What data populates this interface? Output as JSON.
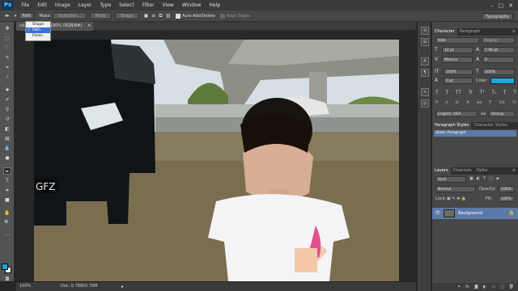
{
  "app": {
    "logo": "Ps"
  },
  "menu": [
    "File",
    "Edit",
    "Image",
    "Layer",
    "Type",
    "Select",
    "Filter",
    "View",
    "Window",
    "Help"
  ],
  "window_controls": [
    "–",
    "▢",
    "✕"
  ],
  "options": {
    "mode_value": "Path",
    "make_label": "Make:",
    "selection_btn": "Selection...",
    "mask_btn": "Mask",
    "shape_btn": "Shape",
    "auto_add_delete": "Auto Add/Delete",
    "align_edges": "Align Edges"
  },
  "workspace": "Typography",
  "mode_dropdown": {
    "items": [
      "Shape",
      "Path",
      "Pixels"
    ],
    "selected": "Path"
  },
  "document": {
    "tab_title": "cd...728.jpg @ 100% (RGB/8#)",
    "close": "✕"
  },
  "status": {
    "zoom": "100%",
    "doc": "Doc: 0.78M/0.78M",
    "arrow": "▸"
  },
  "character_panel": {
    "tabs": [
      "Character",
      "Paragraph"
    ],
    "font_family": "Italo",
    "font_style": "Regular",
    "size": "12 pt",
    "leading": "7.96 pt",
    "kerning": "Metrics",
    "tracking": "0",
    "vscale": "100%",
    "hscale": "100%",
    "baseline": "0 pt",
    "color_label": "Color:",
    "style_buttons": [
      "T",
      "T",
      "TT",
      "Tr",
      "T¹",
      "T₁",
      "T",
      "T"
    ],
    "ligatures": [
      "fi",
      "σ",
      "st",
      "A",
      "aa",
      "T",
      "1st",
      "½"
    ],
    "language": "English: USA",
    "antialias_icon": "aa",
    "antialias": "Strong"
  },
  "paragraph_styles": {
    "tabs": [
      "Paragraph Styles",
      "Character Styles"
    ],
    "item": "Basic Paragraph"
  },
  "layers_panel": {
    "tabs": [
      "Layers",
      "Channels",
      "Paths"
    ],
    "kind": "Kind",
    "blend": "Normal",
    "opacity_label": "Opacity:",
    "opacity": "100%",
    "lock_label": "Lock:",
    "fill_label": "Fill:",
    "fill": "100%",
    "layer_name": "Background"
  },
  "colors": {
    "accent": "#1aa8e0",
    "color_swatch": "#1aa8e0",
    "selection": "#3a6fd8"
  }
}
